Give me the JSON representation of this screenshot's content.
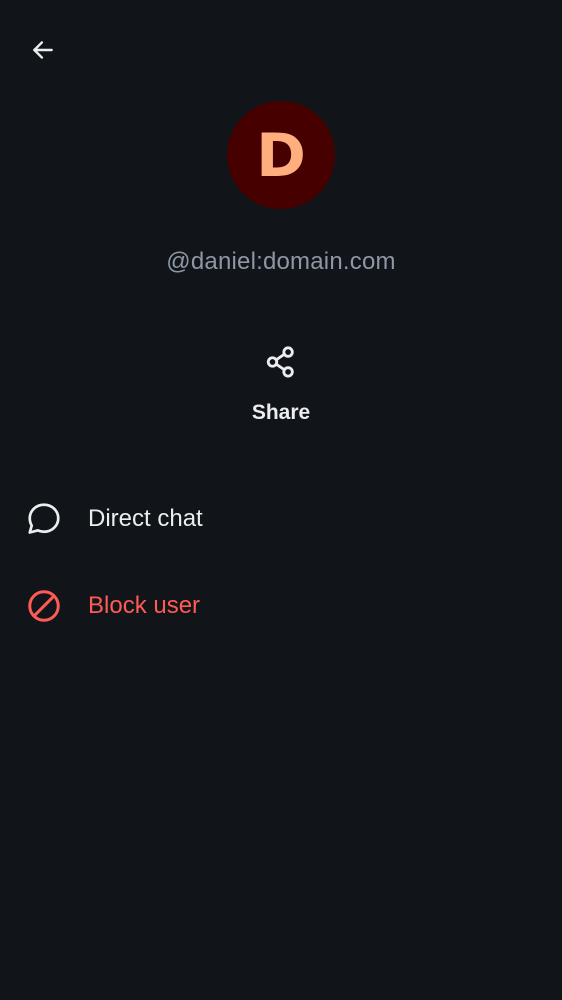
{
  "header": {
    "back_icon": "arrow-left-icon"
  },
  "profile": {
    "avatar_letter": "D",
    "avatar_bg": "#470000",
    "avatar_fg": "#ffae7d",
    "user_id": "@daniel:domain.com"
  },
  "actions": {
    "share_icon": "share-icon",
    "share_label": "Share"
  },
  "menu": {
    "items": [
      {
        "label": "Direct chat",
        "icon": "chat-bubble-icon",
        "color": "#ebedf0"
      },
      {
        "label": "Block user",
        "icon": "block-icon",
        "color": "#ff5b55"
      }
    ]
  },
  "colors": {
    "background": "#111418",
    "secondary_text": "#8d97a5",
    "danger": "#ff5b55"
  }
}
